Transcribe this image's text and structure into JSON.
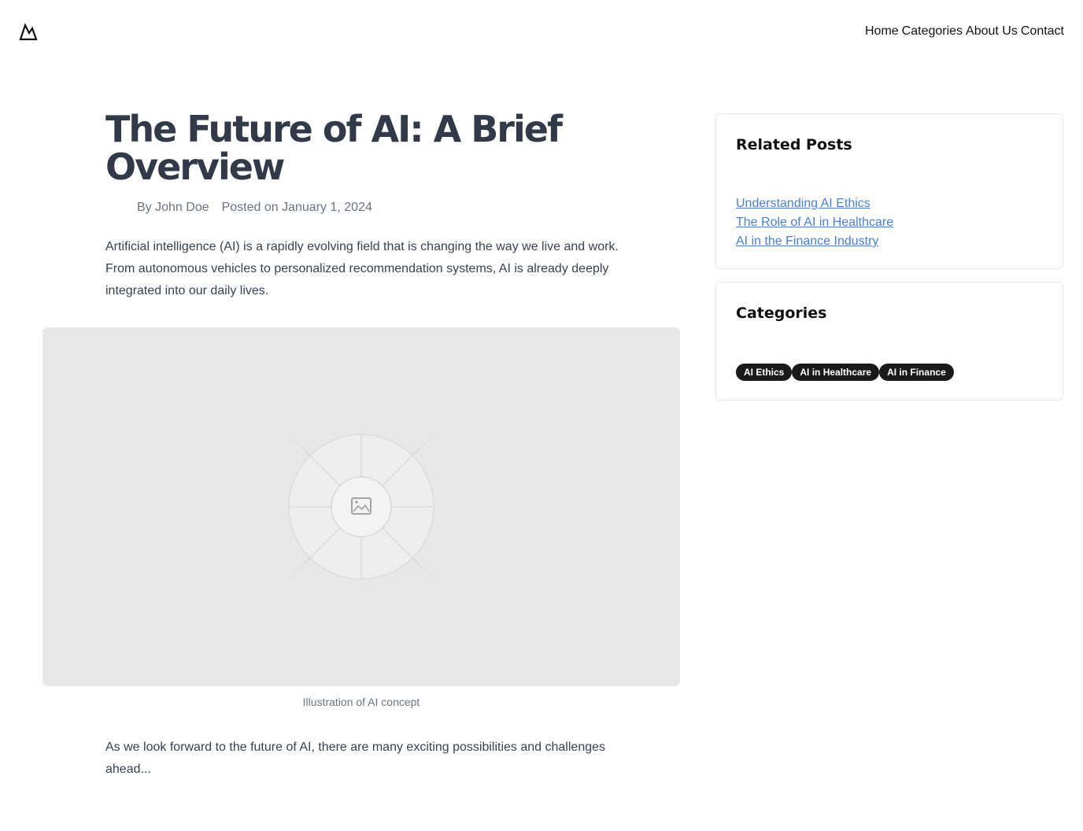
{
  "header": {
    "logo_icon": "mountain-logo-icon",
    "nav": [
      "Home",
      "Categories",
      "About Us",
      "Contact"
    ]
  },
  "article": {
    "title": "The Future of AI: A Brief Overview",
    "author": "By John Doe",
    "posted": "Posted on January 1, 2024",
    "intro": "Artificial intelligence (AI) is a rapidly evolving field that is changing the way we live and work. From autonomous vehicles to personalized recommendation systems, AI is already deeply integrated into our daily lives.",
    "image_icon": "image-placeholder-icon",
    "caption": "Illustration of AI concept",
    "outro": "As we look forward to the future of AI, there are many exciting possibilities and challenges ahead..."
  },
  "sidebar": {
    "related": {
      "heading": "Related Posts",
      "links": [
        "Understanding AI Ethics",
        "The Role of AI in Healthcare",
        "AI in the Finance Industry"
      ]
    },
    "categories": {
      "heading": "Categories",
      "tags": [
        "AI Ethics",
        "AI in Healthcare",
        "AI in Finance"
      ]
    }
  },
  "colors": {
    "title": "#323a49",
    "link": "#4a7fd0",
    "tag_bg": "#1a1a1a"
  }
}
